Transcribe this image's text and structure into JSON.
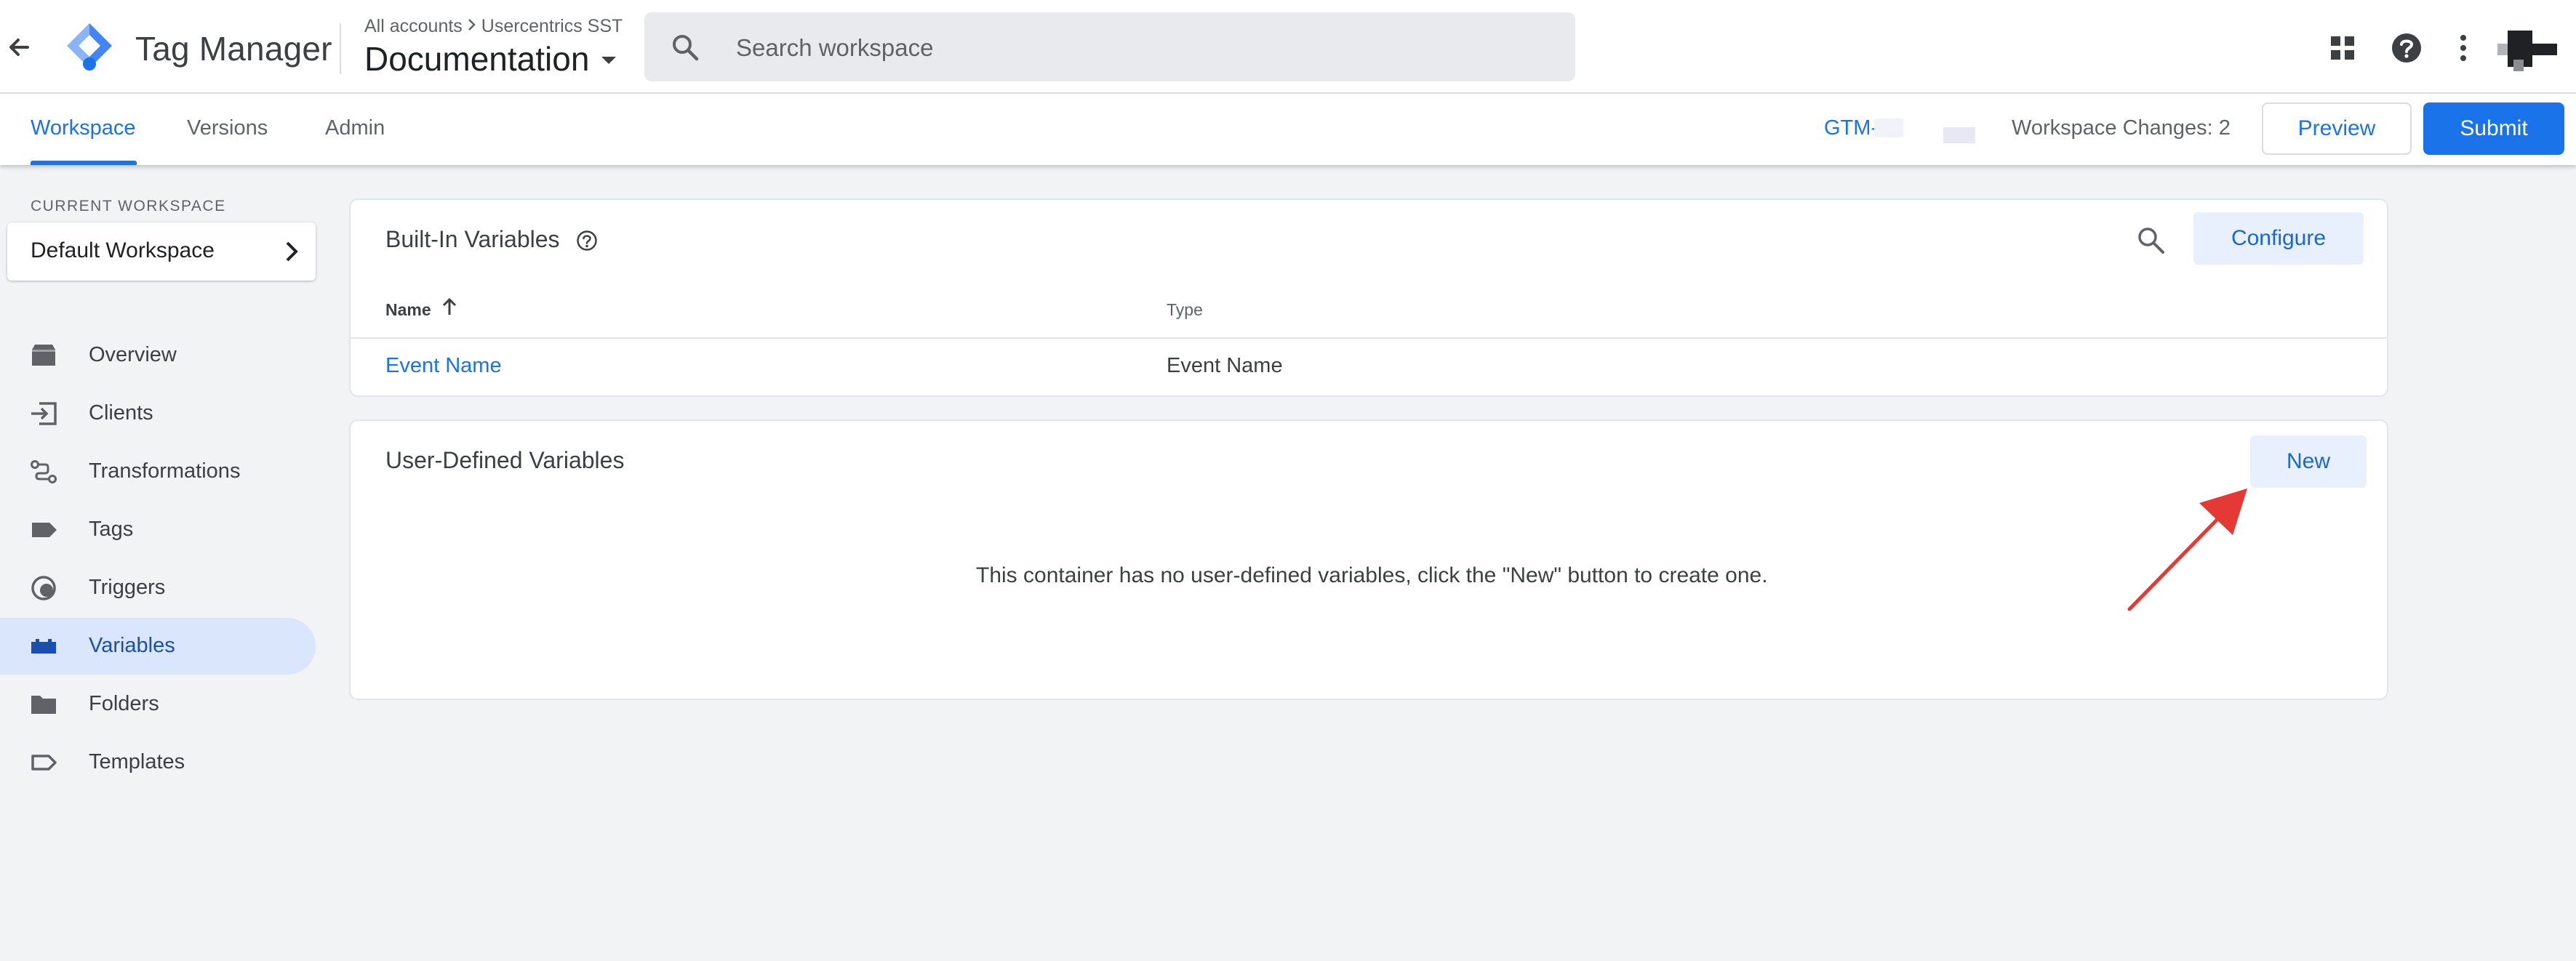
{
  "header": {
    "app_name": "Tag Manager",
    "breadcrumb_all_accounts": "All accounts",
    "breadcrumb_account": "Usercentrics SST",
    "container_name": "Documentation",
    "search_placeholder": "Search workspace",
    "icons": [
      "back-arrow-icon",
      "tag-manager-logo",
      "chevron-right-icon",
      "caret-down-icon",
      "search-icon",
      "apps-grid-icon",
      "help-icon",
      "more-vert-icon"
    ]
  },
  "subnav": {
    "tabs": [
      {
        "label": "Workspace",
        "active": true
      },
      {
        "label": "Versions",
        "active": false
      },
      {
        "label": "Admin",
        "active": false
      }
    ],
    "gtm_id": "GTM-",
    "workspace_changes": "Workspace Changes: 2",
    "preview_label": "Preview",
    "submit_label": "Submit"
  },
  "sidebar": {
    "current_workspace_label": "CURRENT WORKSPACE",
    "workspace_name": "Default Workspace",
    "items": [
      {
        "label": "Overview",
        "icon": "overview-icon",
        "active": false
      },
      {
        "label": "Clients",
        "icon": "clients-icon",
        "active": false
      },
      {
        "label": "Transformations",
        "icon": "transformations-icon",
        "active": false
      },
      {
        "label": "Tags",
        "icon": "tag-icon",
        "active": false
      },
      {
        "label": "Triggers",
        "icon": "triggers-icon",
        "active": false
      },
      {
        "label": "Variables",
        "icon": "variables-icon",
        "active": true
      },
      {
        "label": "Folders",
        "icon": "folder-icon",
        "active": false
      },
      {
        "label": "Templates",
        "icon": "templates-icon",
        "active": false
      }
    ]
  },
  "builtin": {
    "title": "Built-In Variables",
    "configure_label": "Configure",
    "columns": [
      "Name",
      "Type"
    ],
    "rows": [
      {
        "name": "Event Name",
        "type": "Event Name"
      }
    ]
  },
  "userdefined": {
    "title": "User-Defined Variables",
    "new_label": "New",
    "empty_message": "This container has no user-defined variables, click the \"New\" button to create one."
  },
  "colors": {
    "accent": "#1a73e8",
    "active_nav_bg": "#d9e6fc",
    "soft_button_bg": "#e8f0fe",
    "annotation_arrow": "#e53935",
    "page_bg": "#f1f3f4"
  }
}
